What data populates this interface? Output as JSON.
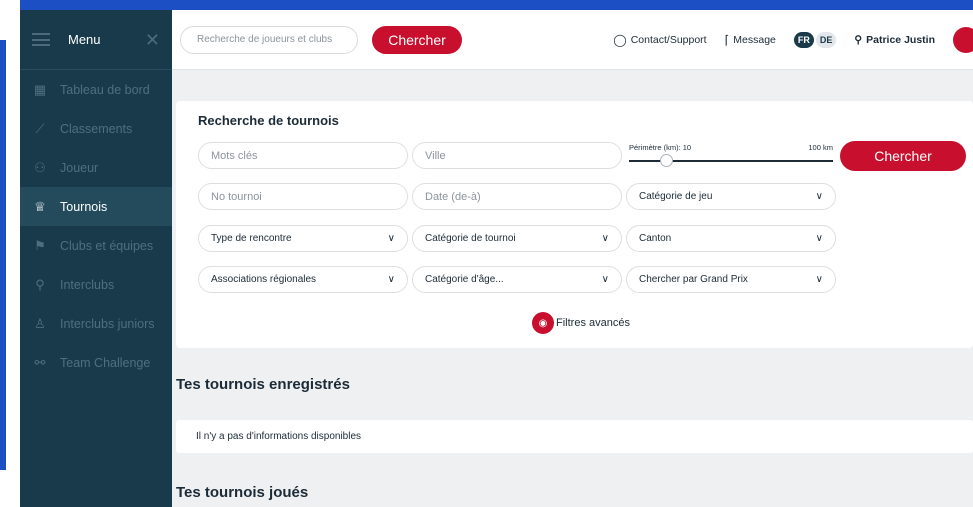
{
  "sidebar": {
    "menu_label": "Menu",
    "close_glyph": "✕",
    "items": [
      {
        "label": "Tableau de bord",
        "icon": "dashboard-icon",
        "glyph": "▦"
      },
      {
        "label": "Classements",
        "icon": "chart-icon",
        "glyph": "⟋"
      },
      {
        "label": "Joueur",
        "icon": "players-icon",
        "glyph": "⚇"
      },
      {
        "label": "Tournois",
        "icon": "trophy-icon",
        "glyph": "♕",
        "active": true
      },
      {
        "label": "Clubs et équipes",
        "icon": "flag-icon",
        "glyph": "⚑"
      },
      {
        "label": "Interclubs",
        "icon": "rackets-icon",
        "glyph": "⚲"
      },
      {
        "label": "Interclubs juniors",
        "icon": "junior-icon",
        "glyph": "♙"
      },
      {
        "label": "Team Challenge",
        "icon": "team-icon",
        "glyph": "⚯"
      }
    ]
  },
  "topbar": {
    "search_placeholder": "Recherche de joueurs et clubs",
    "search_button": "Chercher",
    "contact_label": "Contact/Support",
    "message_label": "Message",
    "lang_active": "FR",
    "lang_other": "DE",
    "user_name": "Patrice Justin"
  },
  "search_card": {
    "title": "Recherche de tournois",
    "keywords_placeholder": "Mots clés",
    "city_placeholder": "Ville",
    "perimeter_label": "Périmètre (km): 10",
    "perimeter_max": "100 km",
    "perimeter_value_km": 10,
    "search_button": "Chercher",
    "tournament_no_placeholder": "No tournoi",
    "date_placeholder": "Date (de-à)",
    "game_category": "Catégorie de jeu",
    "match_type": "Type de rencontre",
    "tournament_category": "Catégorie de tournoi",
    "canton": "Canton",
    "regional_associations": "Associations régionales",
    "age_category": "Catégorie d'âge...",
    "grand_prix": "Chercher par Grand Prix",
    "advanced_filters": "Filtres avancés"
  },
  "registered": {
    "title": "Tes tournois enregistrés",
    "empty_text": "Il n'y a pas d'informations disponibles"
  },
  "played": {
    "title": "Tes tournois joués"
  },
  "colors": {
    "brand_red": "#c8102e",
    "sidebar_bg": "#183a4a",
    "frame_blue": "#1c4fc4"
  }
}
